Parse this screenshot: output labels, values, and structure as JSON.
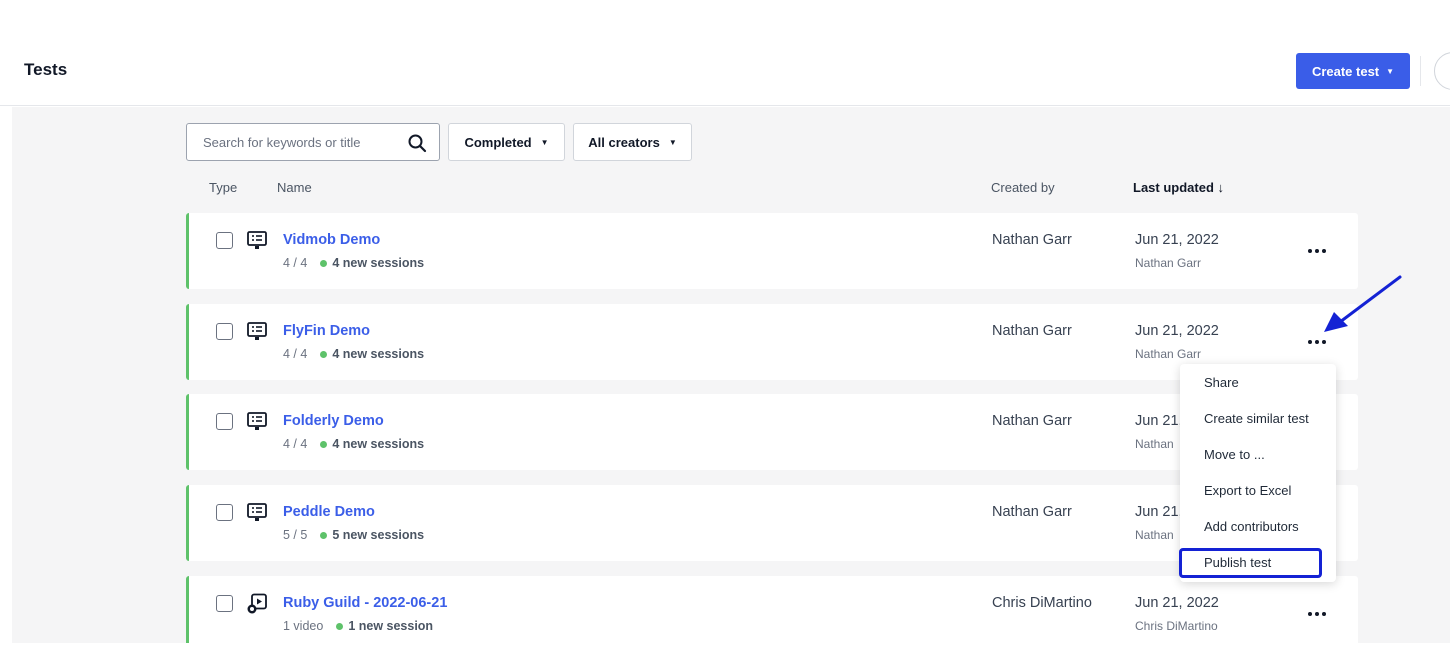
{
  "header": {
    "title": "Tests",
    "create_label": "Create test"
  },
  "toolbar": {
    "search_placeholder": "Search for keywords or title",
    "filter_status": "Completed",
    "filter_creator": "All creators"
  },
  "columns": {
    "type": "Type",
    "name": "Name",
    "created_by": "Created by",
    "last_updated": "Last updated ↓"
  },
  "rows": [
    {
      "title": "Vidmob Demo",
      "count": "4 / 4",
      "sessions": "4 new sessions",
      "creator": "Nathan Garr",
      "date": "Jun 21, 2022",
      "updater": "Nathan Garr",
      "icon": "monitor-icon"
    },
    {
      "title": "FlyFin Demo",
      "count": "4 / 4",
      "sessions": "4 new sessions",
      "creator": "Nathan Garr",
      "date": "Jun 21, 2022",
      "updater": "Nathan Garr",
      "icon": "monitor-icon"
    },
    {
      "title": "Folderly Demo",
      "count": "4 / 4",
      "sessions": "4 new sessions",
      "creator": "Nathan Garr",
      "date": "Jun 21,",
      "updater": "Nathan",
      "icon": "monitor-icon"
    },
    {
      "title": "Peddle Demo",
      "count": "5 / 5",
      "sessions": "5 new sessions",
      "creator": "Nathan Garr",
      "date": "Jun 21,",
      "updater": "Nathan",
      "icon": "monitor-icon"
    },
    {
      "title": "Ruby Guild - 2022-06-21",
      "count": "1 video",
      "sessions": "1 new session",
      "creator": "Chris DiMartino",
      "date": "Jun 21, 2022",
      "updater": "Chris DiMartino",
      "icon": "video-icon"
    }
  ],
  "menu": {
    "items": [
      "Share",
      "Create similar test",
      "Move to ...",
      "Export to Excel",
      "Add contributors",
      "Publish test"
    ]
  },
  "colors": {
    "accent": "#3a5de8",
    "status_green": "#5ec26a",
    "annotation_blue": "#1422d4"
  }
}
